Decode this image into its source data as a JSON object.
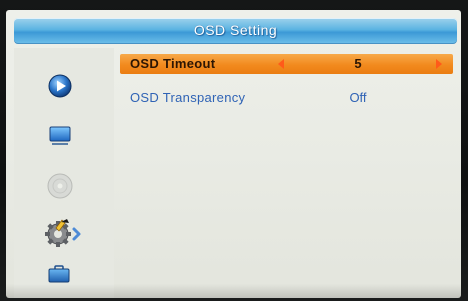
{
  "window": {
    "title": "OSD Setting"
  },
  "sidebar": {
    "items": [
      {
        "icon": "play-circle-icon",
        "selected": false
      },
      {
        "icon": "tv-monitor-icon",
        "selected": false
      },
      {
        "icon": "disc-icon",
        "selected": false
      },
      {
        "icon": "settings-gear-icon",
        "selected": true
      },
      {
        "icon": "toolbox-icon",
        "selected": false
      }
    ]
  },
  "menu": {
    "items": [
      {
        "label": "OSD Timeout",
        "value": "5",
        "selected": true
      },
      {
        "label": "OSD Transparency",
        "value": "Off",
        "selected": false
      }
    ]
  },
  "colors": {
    "title_bar": "#4aa8dd",
    "selection": "#f28a1e",
    "text_unselected": "#2f63b5",
    "background": "#eef0ea"
  }
}
